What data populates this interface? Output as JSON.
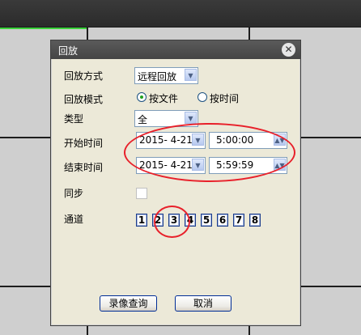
{
  "dialog": {
    "title": "回放",
    "close_icon": "close-icon",
    "fields": {
      "mode_label": "回放方式",
      "mode_value": "远程回放",
      "pattern_label": "回放模式",
      "pattern_by_file": "按文件",
      "pattern_by_time": "按时间",
      "pattern_selected": "按文件",
      "type_label": "类型",
      "type_value": "全",
      "start_label": "开始时间",
      "start_date": "2015- 4-21",
      "start_time": "5:00:00",
      "end_label": "结束时间",
      "end_date": "2015- 4-21",
      "end_time": "5:59:59",
      "sync_label": "同步",
      "sync_checked": false,
      "channel_label": "通道",
      "channels": [
        "1",
        "2",
        "3",
        "4",
        "5",
        "6",
        "7",
        "8"
      ]
    },
    "buttons": {
      "query": "录像查询",
      "cancel": "取消"
    }
  },
  "annotation_color": "#e8202a"
}
